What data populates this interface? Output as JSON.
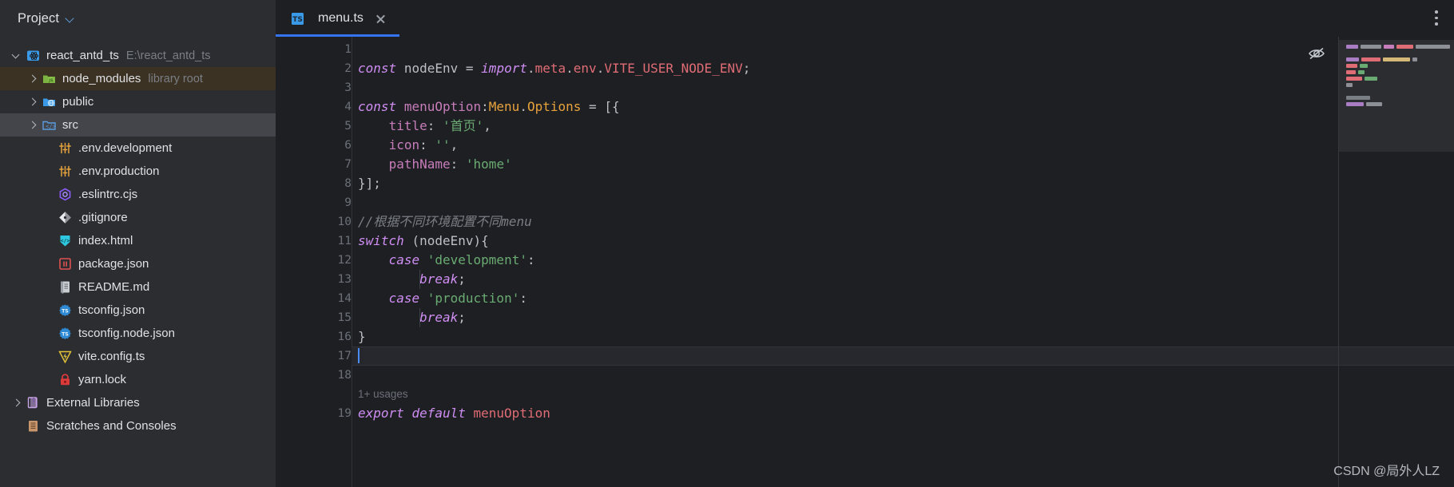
{
  "sidebar": {
    "panel_title": "Project",
    "tree": [
      {
        "indent": 0,
        "arrow": "down",
        "icon": "react-project-icon",
        "label": "react_antd_ts",
        "hint": "E:\\react_antd_ts",
        "state": "none"
      },
      {
        "indent": 1,
        "arrow": "right",
        "icon": "node-modules-icon",
        "label": "node_modules",
        "hint": "library root",
        "state": "sel-amber"
      },
      {
        "indent": 1,
        "arrow": "right",
        "icon": "public-folder-icon",
        "label": "public",
        "hint": "",
        "state": "none"
      },
      {
        "indent": 1,
        "arrow": "right",
        "icon": "source-folder-icon",
        "label": "src",
        "hint": "",
        "state": "sel-grey"
      },
      {
        "indent": 2,
        "arrow": "none",
        "icon": "env-file-icon",
        "label": ".env.development",
        "hint": "",
        "state": "none"
      },
      {
        "indent": 2,
        "arrow": "none",
        "icon": "env-file-icon",
        "label": ".env.production",
        "hint": "",
        "state": "none"
      },
      {
        "indent": 2,
        "arrow": "none",
        "icon": "eslint-file-icon",
        "label": ".eslintrc.cjs",
        "hint": "",
        "state": "none"
      },
      {
        "indent": 2,
        "arrow": "none",
        "icon": "gitignore-file-icon",
        "label": ".gitignore",
        "hint": "",
        "state": "none"
      },
      {
        "indent": 2,
        "arrow": "none",
        "icon": "html-file-icon",
        "label": "index.html",
        "hint": "",
        "state": "none"
      },
      {
        "indent": 2,
        "arrow": "none",
        "icon": "package-json-icon",
        "label": "package.json",
        "hint": "",
        "state": "none"
      },
      {
        "indent": 2,
        "arrow": "none",
        "icon": "markdown-file-icon",
        "label": "README.md",
        "hint": "",
        "state": "none"
      },
      {
        "indent": 2,
        "arrow": "none",
        "icon": "tsconfig-file-icon",
        "label": "tsconfig.json",
        "hint": "",
        "state": "none"
      },
      {
        "indent": 2,
        "arrow": "none",
        "icon": "tsconfig-file-icon",
        "label": "tsconfig.node.json",
        "hint": "",
        "state": "none"
      },
      {
        "indent": 2,
        "arrow": "none",
        "icon": "vite-config-icon",
        "label": "vite.config.ts",
        "hint": "",
        "state": "none"
      },
      {
        "indent": 2,
        "arrow": "none",
        "icon": "lock-file-icon",
        "label": "yarn.lock",
        "hint": "",
        "state": "none"
      },
      {
        "indent": 0,
        "arrow": "right",
        "icon": "external-libraries-icon",
        "label": "External Libraries",
        "hint": "",
        "state": "none"
      },
      {
        "indent": 0,
        "arrow": "none",
        "icon": "scratches-icon",
        "label": "Scratches and Consoles",
        "hint": "",
        "state": "none"
      }
    ]
  },
  "editor": {
    "tab": {
      "label": "menu.ts",
      "icon": "typescript-file-icon"
    },
    "usage_hint": "1+ usages",
    "lines": [
      {
        "n": "1",
        "gutter_mark": "",
        "text": ""
      },
      {
        "n": "2",
        "gutter_mark": "",
        "text": "const nodeEnv = import.meta.env.VITE_USER_NODE_ENV;"
      },
      {
        "n": "3",
        "gutter_mark": "",
        "text": ""
      },
      {
        "n": "4",
        "gutter_mark": "",
        "text": "const menuOption:Menu.Options = [{"
      },
      {
        "n": "5",
        "gutter_mark": "fx-marker",
        "text": "    title: '首页',"
      },
      {
        "n": "6",
        "gutter_mark": "fx-marker",
        "text": "    icon: '',"
      },
      {
        "n": "7",
        "gutter_mark": "fx-marker",
        "text": "    pathName: 'home'"
      },
      {
        "n": "8",
        "gutter_mark": "",
        "text": "}];"
      },
      {
        "n": "9",
        "gutter_mark": "",
        "text": ""
      },
      {
        "n": "10",
        "gutter_mark": "",
        "text": "//根据不同环境配置不同menu"
      },
      {
        "n": "11",
        "gutter_mark": "",
        "text": "switch (nodeEnv){"
      },
      {
        "n": "12",
        "gutter_mark": "",
        "text": "    case 'development':"
      },
      {
        "n": "13",
        "gutter_mark": "",
        "text": "        break;"
      },
      {
        "n": "14",
        "gutter_mark": "",
        "text": "    case 'production':"
      },
      {
        "n": "15",
        "gutter_mark": "",
        "text": "        break;"
      },
      {
        "n": "16",
        "gutter_mark": "",
        "text": "}"
      },
      {
        "n": "17",
        "gutter_mark": "",
        "text": ""
      },
      {
        "n": "18",
        "gutter_mark": "",
        "text": ""
      },
      {
        "n": "19",
        "gutter_mark": "",
        "text": "export default menuOption"
      }
    ],
    "icons": {
      "reader_mode": "hidden-eye-icon",
      "inspections_ok": "check-icon",
      "more_options": "kebab-menu-icon"
    }
  },
  "watermark": "CSDN @局外人LZ",
  "colors": {
    "accent": "#3574f0",
    "panel_bg": "#2b2d30",
    "editor_bg": "#1e1f22",
    "selection_amber": "#3c3223",
    "selection_grey": "#43454a",
    "caret": "#4a8bf5",
    "ok_green": "#57965c"
  }
}
